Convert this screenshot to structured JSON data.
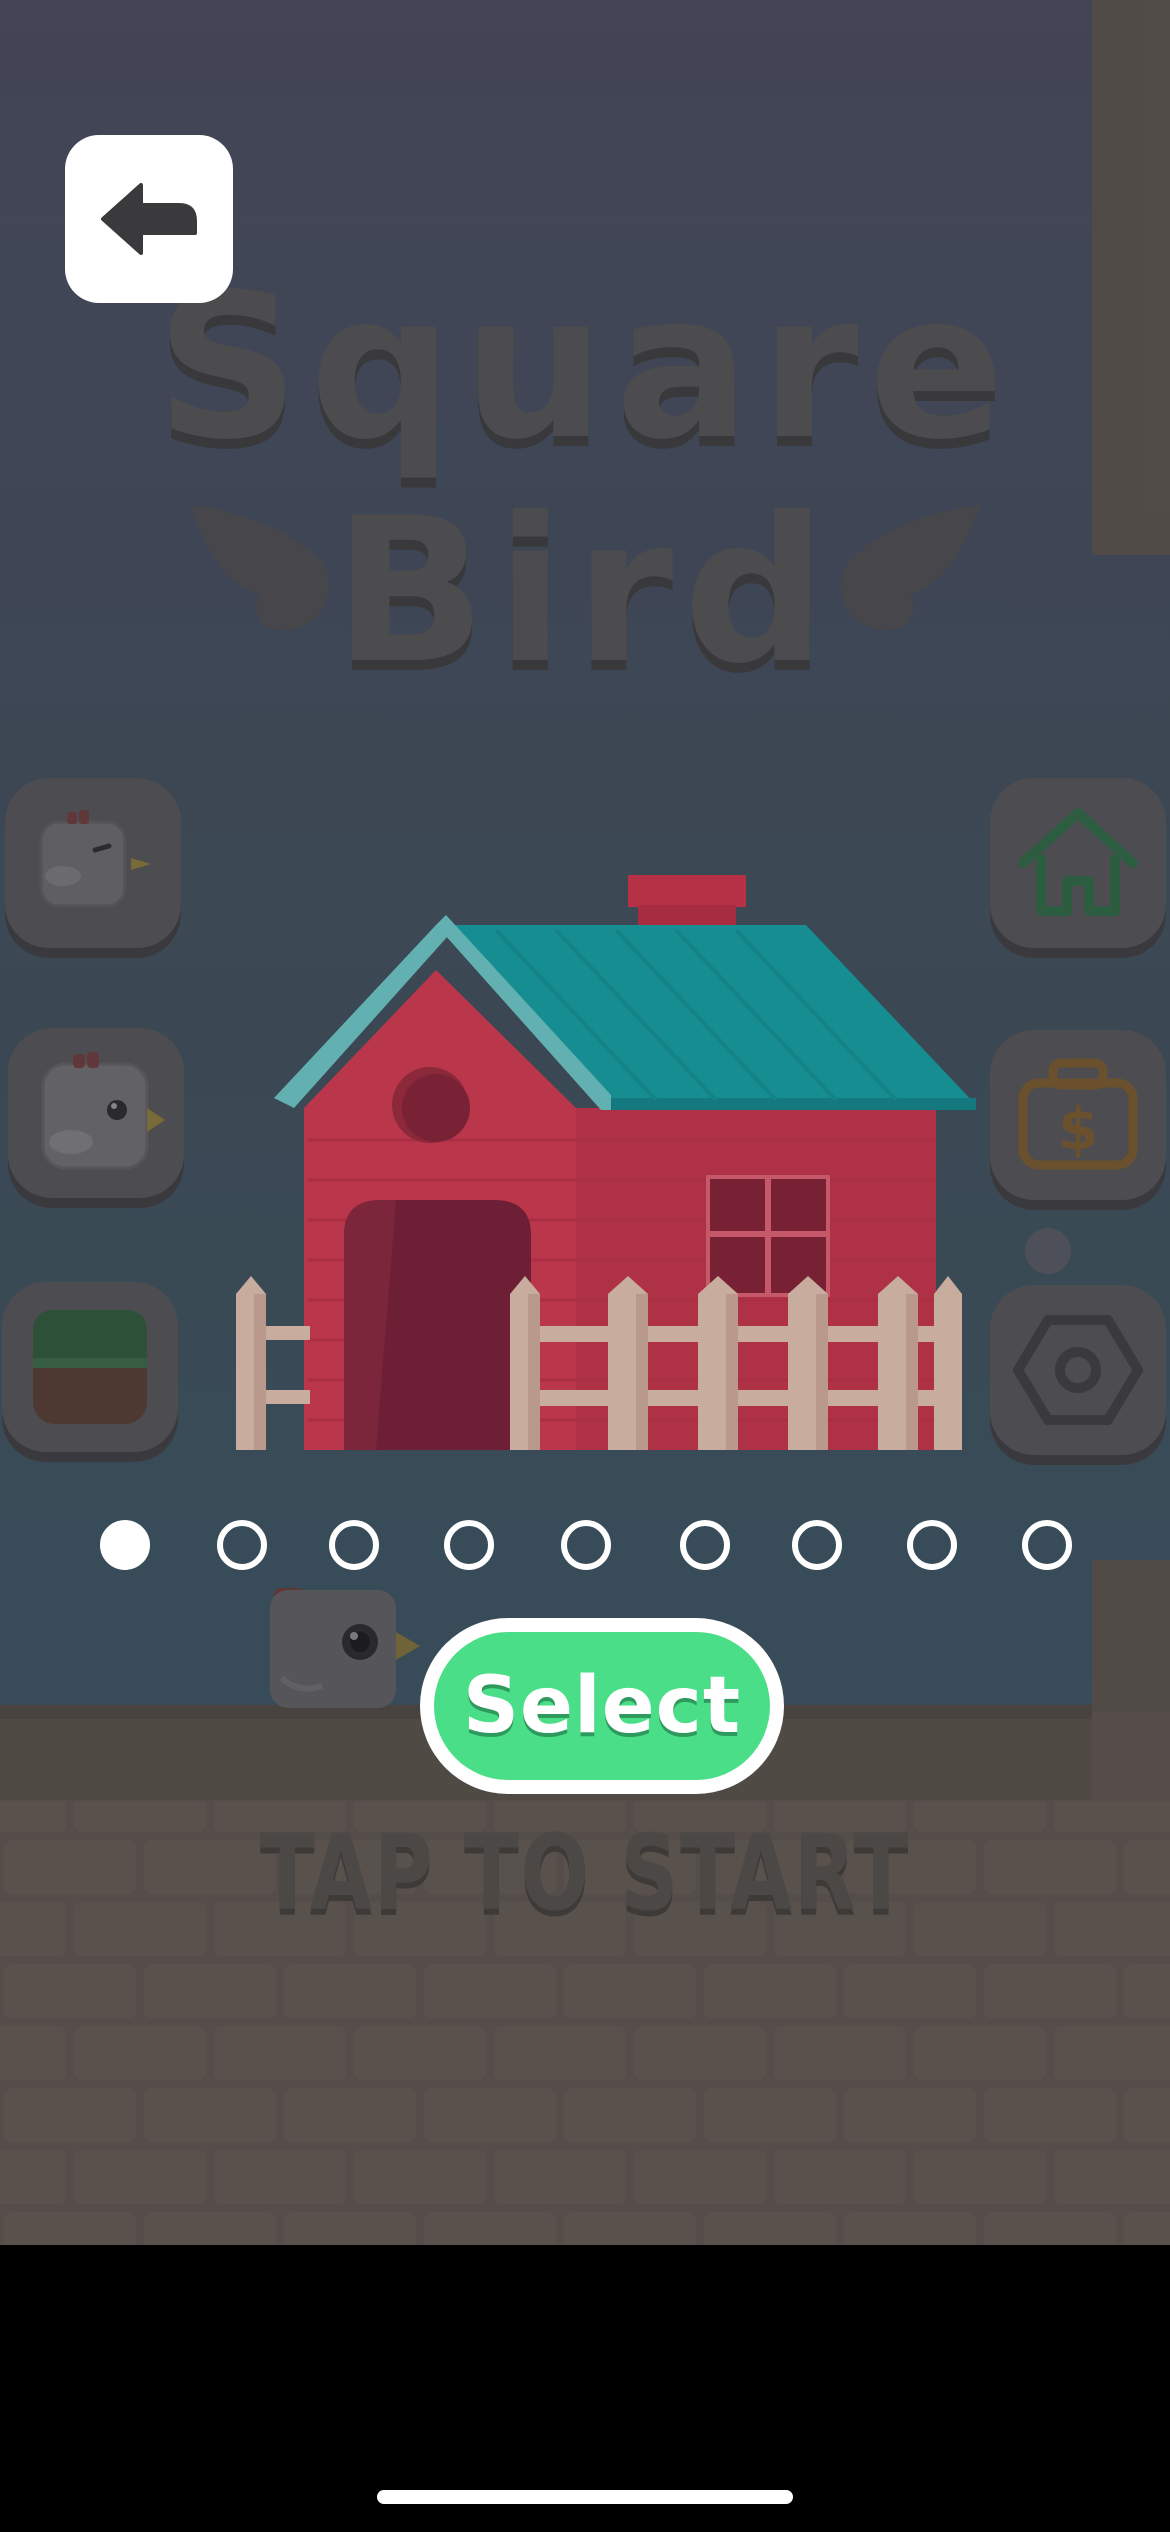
{
  "title": {
    "line1": "Square",
    "line2": "Bird"
  },
  "icons": {
    "back": "back-arrow-icon",
    "skins_top": "sleeping-bird-icon",
    "skins_mid": "bird-icon",
    "backgrounds": "grass-block-icon",
    "home": "home-icon",
    "shop": "money-bag-icon",
    "settings": "settings-hex-icon"
  },
  "carousel": {
    "item_name": "house-scene",
    "pages": [
      {
        "active": true
      },
      {
        "active": false
      },
      {
        "active": false
      },
      {
        "active": false
      },
      {
        "active": false
      },
      {
        "active": false
      },
      {
        "active": false
      },
      {
        "active": false
      },
      {
        "active": false
      }
    ]
  },
  "select_button": {
    "label": "Select"
  },
  "prompt": {
    "text": "TAP TO START"
  },
  "colors": {
    "accent_green": "#4ade88",
    "house_red": "#d93a52",
    "roof_teal": "#13a4a8",
    "fence": "#eccbb8"
  }
}
